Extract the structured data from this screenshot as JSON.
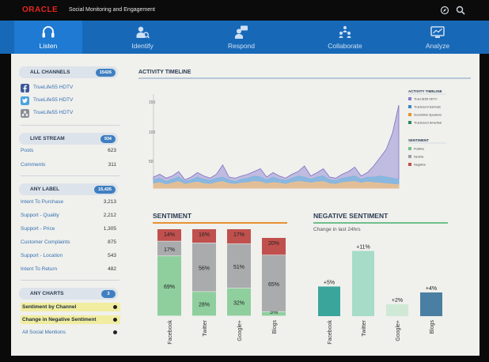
{
  "topbar": {
    "logo": "ORACLE",
    "title": "Social Monitoring and Engagement",
    "icons": [
      "compass-icon",
      "search-icon"
    ]
  },
  "nav": {
    "tabs": [
      {
        "label": "Listen",
        "icon": "headset-icon",
        "active": true
      },
      {
        "label": "Identify",
        "icon": "person-search-icon"
      },
      {
        "label": "Respond",
        "icon": "person-chat-icon"
      },
      {
        "label": "Collaborate",
        "icon": "team-icon"
      },
      {
        "label": "Analyze",
        "icon": "monitor-chart-icon"
      }
    ]
  },
  "sidebar": {
    "channels": {
      "header": "ALL CHANNELS",
      "count": "15426",
      "items": [
        {
          "label": "TrueLife55 HDTV",
          "icon": "facebook-icon"
        },
        {
          "label": "TrueLife55 HDTV",
          "icon": "twitter-icon"
        },
        {
          "label": "TrueLife55 HDTV",
          "icon": "network-icon"
        }
      ]
    },
    "live_stream": {
      "header": "LIVE STREAM",
      "count": "934",
      "items": [
        {
          "label": "Posts",
          "value": "623"
        },
        {
          "label": "Comments",
          "value": "311"
        }
      ]
    },
    "any_label": {
      "header": "ANY LABEL",
      "count": "15,426",
      "items": [
        {
          "label": "Intent To Purchase",
          "value": "3,213"
        },
        {
          "label": "Support - Quality",
          "value": "2,212"
        },
        {
          "label": "Support - Price",
          "value": "1,305"
        },
        {
          "label": "Customer Complaints",
          "value": "875"
        },
        {
          "label": "Support - Location",
          "value": "543"
        },
        {
          "label": "Intent To Return",
          "value": "482"
        }
      ]
    },
    "any_charts": {
      "header": "ANY CHARTS",
      "count": "3",
      "items": [
        {
          "label": "Sentiment by Channel",
          "highlight": true
        },
        {
          "label": "Change in Negative Sentiment",
          "highlight": true
        },
        {
          "label": "All Social Mentions",
          "highlight": false
        }
      ]
    }
  },
  "activity": {
    "title": "ACTIVITY TIMELINE",
    "y_ticks": [
      "150",
      "100",
      "50"
    ],
    "legend_title_1": "ACTIVITY TIMELINE",
    "legend_1": [
      {
        "label": "TrueLife55 HDTV",
        "color": "#8a7bc9"
      },
      {
        "label": "TrueSound Earbuds",
        "color": "#3b86c6"
      },
      {
        "label": "SoundStar Speakers",
        "color": "#e8922f"
      },
      {
        "label": "TrueSound Smartbar",
        "color": "#2f8a5a"
      }
    ],
    "legend_title_2": "SENTIMENT",
    "legend_2": [
      {
        "label": "Positive",
        "color": "#6fbf8a"
      },
      {
        "label": "Neutral",
        "color": "#9aa0a6"
      },
      {
        "label": "Negative",
        "color": "#c0504d"
      }
    ]
  },
  "chart_data": [
    {
      "type": "area",
      "title": "ACTIVITY TIMELINE",
      "ylim": [
        0,
        170
      ],
      "x_count": 40,
      "series": [
        {
          "name": "TrueLife55 HDTV",
          "color": "#b7b1dd",
          "values": [
            20,
            25,
            18,
            22,
            30,
            15,
            20,
            28,
            22,
            18,
            25,
            42,
            20,
            18,
            22,
            25,
            30,
            35,
            20,
            28,
            22,
            18,
            25,
            30,
            40,
            22,
            28,
            35,
            20,
            18,
            25,
            30,
            38,
            22,
            28,
            40,
            55,
            70,
            100,
            150
          ]
        },
        {
          "name": "TrueSound Earbuds",
          "color": "#7fb6df",
          "values": [
            15,
            18,
            12,
            16,
            20,
            12,
            15,
            20,
            16,
            14,
            18,
            20,
            15,
            12,
            16,
            18,
            22,
            20,
            15,
            20,
            16,
            14,
            18,
            22,
            20,
            16,
            20,
            22,
            15,
            14,
            18,
            20,
            22,
            16,
            20,
            20,
            22,
            20,
            18,
            16
          ]
        },
        {
          "name": "SoundStar Speakers",
          "color": "#f1c08a",
          "values": [
            8,
            10,
            6,
            9,
            12,
            7,
            9,
            11,
            8,
            7,
            10,
            12,
            8,
            7,
            9,
            10,
            12,
            11,
            8,
            10,
            9,
            7,
            10,
            12,
            11,
            9,
            11,
            12,
            8,
            7,
            10,
            11,
            12,
            9,
            11,
            10,
            9,
            8,
            7,
            6
          ]
        }
      ]
    },
    {
      "type": "bar",
      "title": "SENTIMENT",
      "categories": [
        "Facebook",
        "Twitter",
        "Google+",
        "Blogs"
      ],
      "series": [
        {
          "name": "Positive",
          "color": "#8fcf9e",
          "values": [
            69,
            28,
            32,
            5
          ]
        },
        {
          "name": "Neutral",
          "color": "#a9abad",
          "values": [
            17,
            56,
            51,
            65
          ]
        },
        {
          "name": "Negative",
          "color": "#c0504d",
          "values": [
            14,
            16,
            17,
            20
          ]
        }
      ],
      "labels": [
        {
          "positive": "69%",
          "neutral": "17%",
          "negative": "14%"
        },
        {
          "positive": "28%",
          "neutral": "56%",
          "negative": "16%"
        },
        {
          "positive": "32%",
          "neutral": "51%",
          "negative": "17%"
        },
        {
          "positive": "5%",
          "neutral": "65%",
          "negative": "20%"
        }
      ],
      "stacked": true
    },
    {
      "type": "bar",
      "title": "NEGATIVE SENTIMENT",
      "subtitle": "Change in last 24hrs",
      "categories": [
        "Facebook",
        "Twitter",
        "Google+",
        "Blogs"
      ],
      "values": [
        5,
        11,
        2,
        4
      ],
      "labels": [
        "+5%",
        "+11%",
        "+2%",
        "+4%"
      ],
      "colors": [
        "#3aa59b",
        "#a7dcc8",
        "#cfe9d6",
        "#4a7fa3"
      ]
    }
  ]
}
